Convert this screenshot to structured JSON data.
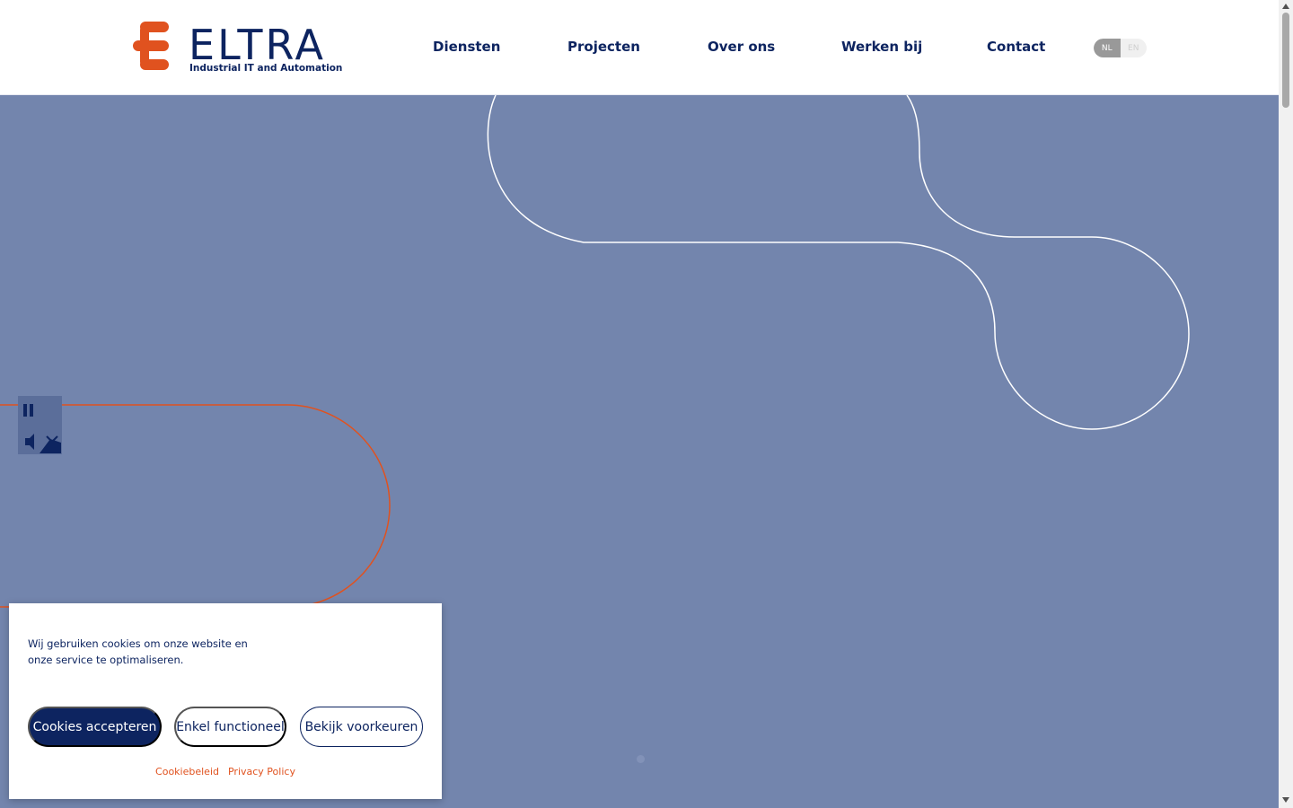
{
  "brand": {
    "name": "ELTRA",
    "tagline": "Industrial IT and Automation",
    "primary_color": "#0d2460",
    "accent_color": "#e0521f"
  },
  "nav": {
    "items": [
      {
        "label": "Diensten"
      },
      {
        "label": "Projecten"
      },
      {
        "label": "Over ons"
      },
      {
        "label": "Werken bij"
      },
      {
        "label": "Contact"
      }
    ]
  },
  "language": {
    "options": [
      "NL",
      "EN"
    ],
    "selected": "NL"
  },
  "hero": {
    "background_color": "#7385ad",
    "video_controls": {
      "pause_icon": "pause-icon",
      "mute_icon": "speaker-muted-icon"
    },
    "slider": {
      "dots": 1,
      "active_index": 0
    }
  },
  "cookie_banner": {
    "message": "Wij gebruiken cookies om onze website en onze service te optimaliseren.",
    "accept_label": "Cookies accepteren",
    "functional_label": "Enkel functioneel",
    "preferences_label": "Bekijk voorkeuren",
    "links": {
      "cookie_policy": "Cookiebeleid",
      "privacy_policy": "Privacy Policy"
    }
  },
  "scrollbar": {
    "up_icon": "scroll-up-icon",
    "down_icon": "scroll-down-icon"
  }
}
